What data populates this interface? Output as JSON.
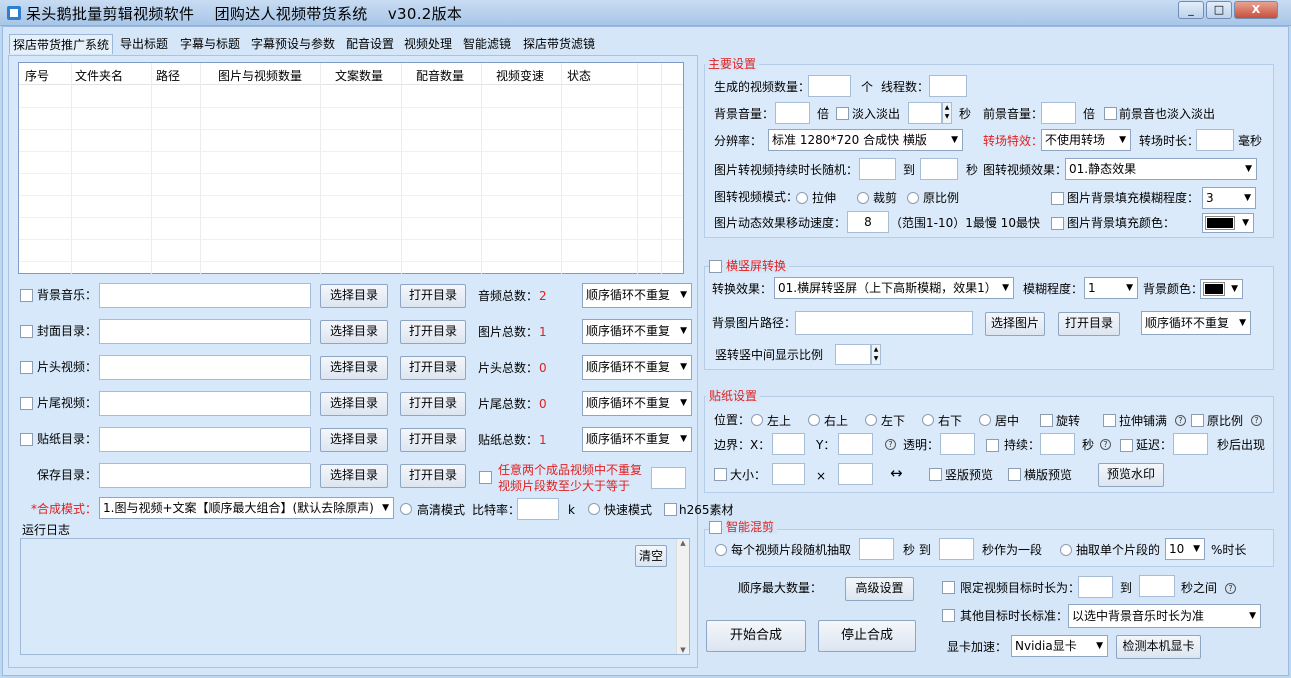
{
  "window": {
    "title": "呆头鹅批量剪辑视频软件    团购达人视频带货系统    v30.2版本",
    "controls": [
      "_",
      "□",
      "X"
    ]
  },
  "tabs": [
    "探店带货推广系统",
    "导出标题",
    "字幕与标题",
    "字幕预设与参数",
    "配音设置",
    "视频处理",
    "智能滤镜",
    "探店带货滤镜"
  ],
  "table": {
    "columns": [
      "序号",
      "文件夹名",
      "路径",
      "图片与视频数量",
      "文案数量",
      "配音数量",
      "视频变速",
      "状态"
    ]
  },
  "dir_rows": [
    {
      "label": "背景音乐：",
      "select_btn": "选择目录",
      "open_btn": "打开目录",
      "count_label": "音频总数：",
      "count": "2",
      "order": "顺序循环不重复"
    },
    {
      "label": "封面目录：",
      "select_btn": "选择目录",
      "open_btn": "打开目录",
      "count_label": "图片总数：",
      "count": "1",
      "order": "顺序循环不重复"
    },
    {
      "label": "片头视频：",
      "select_btn": "选择目录",
      "open_btn": "打开目录",
      "count_label": "片头总数：",
      "count": "0",
      "order": "顺序循环不重复"
    },
    {
      "label": "片尾视频：",
      "select_btn": "选择目录",
      "open_btn": "打开目录",
      "count_label": "片尾总数：",
      "count": "0",
      "order": "顺序循环不重复"
    },
    {
      "label": "贴纸目录：",
      "select_btn": "选择目录",
      "open_btn": "打开目录",
      "count_label": "贴纸总数：",
      "count": "1",
      "order": "顺序循环不重复"
    }
  ],
  "save_row": {
    "label": "保存目录：",
    "select_btn": "选择目录",
    "open_btn": "打开目录",
    "note_line1": "任意两个成品视频中不重复",
    "note_line2": "视频片段数至少大于等于"
  },
  "compose": {
    "label": "*合成模式：",
    "mode": "1.图与视频+文案【顺序最大组合】(默认去除原声)",
    "hq_label": "高清模式",
    "bitrate_label": "比特率：",
    "bitrate_unit": "k",
    "fast_label": "快速模式",
    "h265_label": "h265素材"
  },
  "log": {
    "title": "运行日志",
    "clear_btn": "清空"
  },
  "main_settings": {
    "title": "主要设置",
    "gen_count": "生成的视频数量：",
    "unit_ge": "个",
    "threads": "线程数：",
    "bg_volume": "背景音量：",
    "unit_bei": "倍",
    "fade": "淡入淡出",
    "unit_sec": "秒",
    "front_volume": "前景音量：",
    "unit_bei2": "倍",
    "front_fade": "前景音也淡入淡出",
    "resolution_label": "分辨率：",
    "resolution": "标准 1280*720 合成快 横版",
    "transition_label": "转场特效：",
    "transition": "不使用转场",
    "transition_dur": "转场时长：",
    "unit_ms": "毫秒",
    "img_dur": "图片转视频持续时长随机：",
    "to": "到",
    "unit_sec2": "秒",
    "img_effect_label": "图转视频效果：",
    "img_effect": "01.静态效果",
    "img_mode_label": "图转视频模式：",
    "mode_stretch": "拉伸",
    "mode_crop": "裁剪",
    "mode_ratio": "原比例",
    "blur_fill": "图片背景填充模糊程度：",
    "blur_value": "3",
    "speed_label": "图片动态效果移动速度：",
    "speed_value": "8",
    "speed_hint": "（范围1-10）1最慢 10最快",
    "fill_color": "图片背景填充颜色："
  },
  "hv": {
    "title": "横竖屏转换",
    "effect_label": "转换效果：",
    "effect": "01.横屏转竖屏（上下高斯模糊，效果1）",
    "blur_label": "模糊程度：",
    "blur": "1",
    "bg_color": "背景颜色：",
    "bg_path": "背景图片路径：",
    "select_img": "选择图片",
    "open_dir": "打开目录",
    "order": "顺序循环不重复",
    "ratio_label": "竖转竖中间显示比例"
  },
  "sticker": {
    "title": "贴纸设置",
    "pos_label": "位置：",
    "pos_tl": "左上",
    "pos_tr": "右上",
    "pos_bl": "左下",
    "pos_br": "右下",
    "pos_c": "居中",
    "rotate": "旋转",
    "stretch": "拉伸铺满",
    "ratio": "原比例",
    "border_x": "边界：X：",
    "border_y": "Y：",
    "opacity": "透明：",
    "duration": "持续：",
    "unit_sec": "秒",
    "delay": "延迟：",
    "after": "秒后出现",
    "size": "大小：",
    "times": "×",
    "swap": "↔",
    "vpreview": "竖版预览",
    "hpreview": "横版预览",
    "preview_btn": "预览水印"
  },
  "smart": {
    "title": "智能混剪",
    "random_label": "每个视频片段随机抽取",
    "sec_to": "秒 到",
    "as_seg": "秒作为一段",
    "extract_label": "抽取单个片段的",
    "extract_value": "10",
    "pct": "%时长"
  },
  "bottom": {
    "max_order": "顺序最大数量：",
    "adv_btn": "高级设置",
    "limit_label": "限定视频目标时长为：",
    "to": "到",
    "between": "秒之间",
    "other_label": "其他目标时长标准：",
    "other_value": "以选中背景音乐时长为准",
    "start_btn": "开始合成",
    "stop_btn": "停止合成",
    "gpu_label": "显卡加速：",
    "gpu_value": "Nvidia显卡",
    "detect_btn": "检测本机显卡"
  }
}
